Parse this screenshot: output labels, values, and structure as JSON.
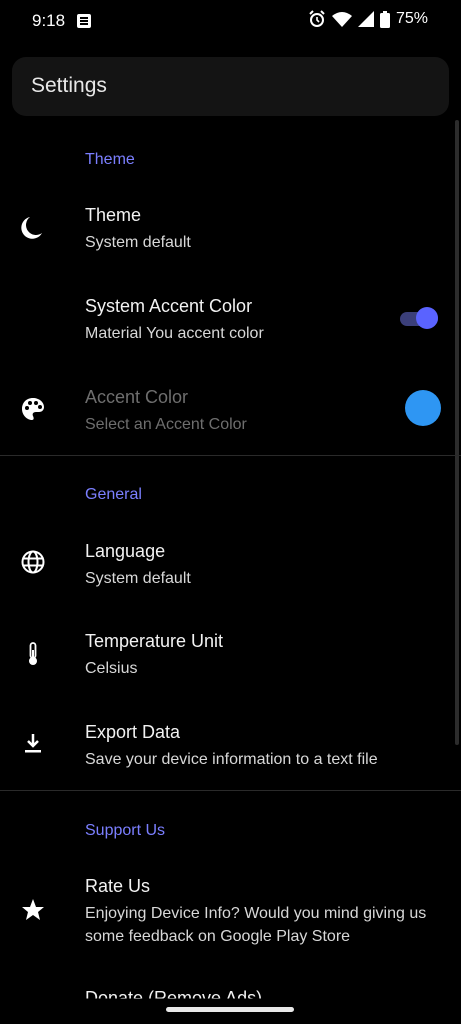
{
  "status_bar": {
    "time": "9:18",
    "battery": "75%"
  },
  "app_bar": {
    "title": "Settings"
  },
  "sections": {
    "theme": {
      "header": "Theme",
      "theme_item": {
        "title": "Theme",
        "subtitle": "System default",
        "icon": "moon-icon"
      },
      "system_accent": {
        "title": "System Accent Color",
        "subtitle": "Material You accent color",
        "enabled": true
      },
      "accent_color": {
        "title": "Accent Color",
        "subtitle": "Select an Accent Color",
        "icon": "palette-icon",
        "swatch": "#2e96f3",
        "disabled": true
      }
    },
    "general": {
      "header": "General",
      "language": {
        "title": "Language",
        "subtitle": "System default",
        "icon": "globe-icon"
      },
      "temperature": {
        "title": "Temperature Unit",
        "subtitle": "Celsius",
        "icon": "thermometer-icon"
      },
      "export": {
        "title": "Export Data",
        "subtitle": "Save your device information to a text file",
        "icon": "download-icon"
      }
    },
    "support": {
      "header": "Support Us",
      "rate": {
        "title": "Rate Us",
        "subtitle": "Enjoying Device Info? Would you mind giving us some feedback on Google Play Store",
        "icon": "star-icon"
      },
      "donate_peek": "Donate (Remove Ads)"
    }
  },
  "colors": {
    "accent": "#7b7fff",
    "toggle_thumb": "#5a63ff",
    "swatch": "#2e96f3"
  }
}
